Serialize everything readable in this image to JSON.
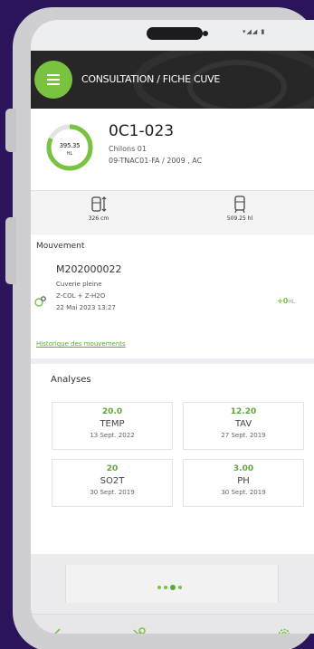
{
  "status_bar": {
    "icons": "▾◢◢ ▮"
  },
  "header": {
    "title": "CONSULTATION / FICHE CUVE"
  },
  "tank": {
    "fill_fraction": 0.82,
    "volume": "395.35",
    "volume_unit": "HL",
    "code": "0C1-023",
    "location": "Chilons 01",
    "reference": "09-TNAC01-FA / 2009 , AC"
  },
  "dimensions": {
    "height": "326 cm",
    "capacity": "509.25 hl"
  },
  "movement": {
    "section_title": "Mouvement",
    "code": "M202000022",
    "type": "Cuverie pleine",
    "products": "Z-COL + Z-H2O",
    "date": "22 Mai 2023 13:27",
    "quantity": "+0",
    "quantity_unit": "HL",
    "history_link": "Historique des mouvements"
  },
  "analyses": {
    "section_title": "Analyses",
    "items": [
      {
        "value": "20.0",
        "name": "TEMP",
        "date": "13 Sept. 2022"
      },
      {
        "value": "12.20",
        "name": "TAV",
        "date": "27 Sept. 2019"
      },
      {
        "value": "20",
        "name": "SO2T",
        "date": "30 Sept. 2019"
      },
      {
        "value": "3.00",
        "name": "PH",
        "date": "30 Sept. 2019"
      }
    ]
  },
  "colors": {
    "accent": "#79c340",
    "accent_dark": "#5fa63c",
    "header_bg": "#272727",
    "page_bg": "#2b1459"
  },
  "icons": {
    "menu": "hamburger-icon",
    "height": "tank-height-icon",
    "capacity": "tank-capacity-icon",
    "movement": "movement-icon",
    "back": "arrow-left-icon",
    "tools": "tools-icon",
    "settings": "gear-icon"
  }
}
